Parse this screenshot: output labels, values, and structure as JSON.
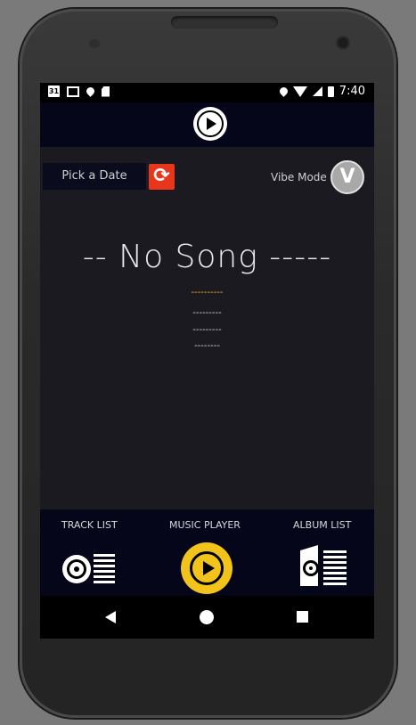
{
  "status_bar": {
    "calendar_day": "31",
    "time": "7:40",
    "icons_left": [
      "calendar-icon",
      "mail-icon",
      "location-icon",
      "sd-card-icon"
    ],
    "icons_right": [
      "location-icon",
      "wifi-icon",
      "signal-icon",
      "battery-icon"
    ]
  },
  "controls": {
    "date_picker_label": "Pick a Date",
    "vibe_mode_label": "Vibe Mode",
    "vibe_button_letter": "V"
  },
  "now_playing": {
    "title": "-- No Song -----",
    "artist": "----------",
    "line2": "---------",
    "line3": "---------",
    "line4": "--------"
  },
  "bottom_nav": {
    "track_list_label": "TRACK LIST",
    "music_player_label": "MUSIC PLAYER",
    "album_list_label": "ALBUM LIST"
  },
  "colors": {
    "screen_bg": "#1b1a20",
    "bar_bg": "#06061a",
    "accent_yellow": "#f2c31b",
    "refresh_red": "#e8361c"
  }
}
